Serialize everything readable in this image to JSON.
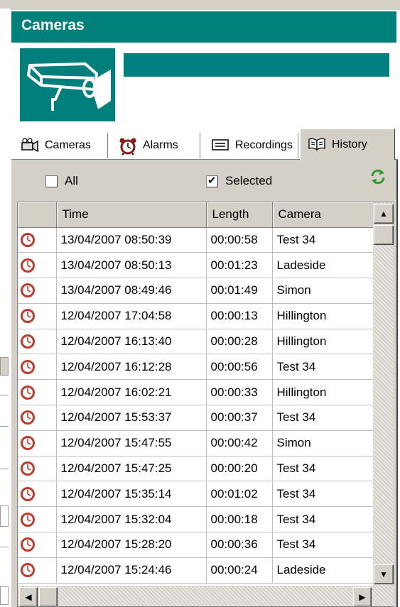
{
  "panel": {
    "title": "Cameras"
  },
  "tabs": [
    {
      "label": "Cameras",
      "icon": "camera-icon",
      "active": false
    },
    {
      "label": "Alarms",
      "icon": "alarm-clock-icon",
      "active": false
    },
    {
      "label": "Recordings",
      "icon": "recordings-icon",
      "active": false
    },
    {
      "label": "History",
      "icon": "book-icon",
      "active": true
    }
  ],
  "filters": {
    "all": {
      "label": "All",
      "checked": false
    },
    "selected": {
      "label": "Selected",
      "checked": true
    }
  },
  "table": {
    "columns": [
      "",
      "Time",
      "Length",
      "Camera"
    ],
    "rows": [
      {
        "time": "13/04/2007 08:50:39",
        "length": "00:00:58",
        "camera": "Test 34"
      },
      {
        "time": "13/04/2007 08:50:13",
        "length": "00:01:23",
        "camera": "Ladeside"
      },
      {
        "time": "13/04/2007 08:49:46",
        "length": "00:01:49",
        "camera": "Simon"
      },
      {
        "time": "12/04/2007 17:04:58",
        "length": "00:00:13",
        "camera": "Hillington"
      },
      {
        "time": "12/04/2007 16:13:40",
        "length": "00:00:28",
        "camera": "Hillington"
      },
      {
        "time": "12/04/2007 16:12:28",
        "length": "00:00:56",
        "camera": "Test 34"
      },
      {
        "time": "12/04/2007 16:02:21",
        "length": "00:00:33",
        "camera": "Hillington"
      },
      {
        "time": "12/04/2007 15:53:37",
        "length": "00:00:37",
        "camera": "Test 34"
      },
      {
        "time": "12/04/2007 15:47:55",
        "length": "00:00:42",
        "camera": "Simon"
      },
      {
        "time": "12/04/2007 15:47:25",
        "length": "00:00:20",
        "camera": "Test 34"
      },
      {
        "time": "12/04/2007 15:35:14",
        "length": "00:01:02",
        "camera": "Test 34"
      },
      {
        "time": "12/04/2007 15:32:04",
        "length": "00:00:18",
        "camera": "Test 34"
      },
      {
        "time": "12/04/2007 15:28:20",
        "length": "00:00:36",
        "camera": "Test 34"
      },
      {
        "time": "12/04/2007 15:24:46",
        "length": "00:00:24",
        "camera": "Ladeside"
      }
    ]
  },
  "colors": {
    "accent": "#00807a",
    "row_icon": "#c0392b"
  }
}
